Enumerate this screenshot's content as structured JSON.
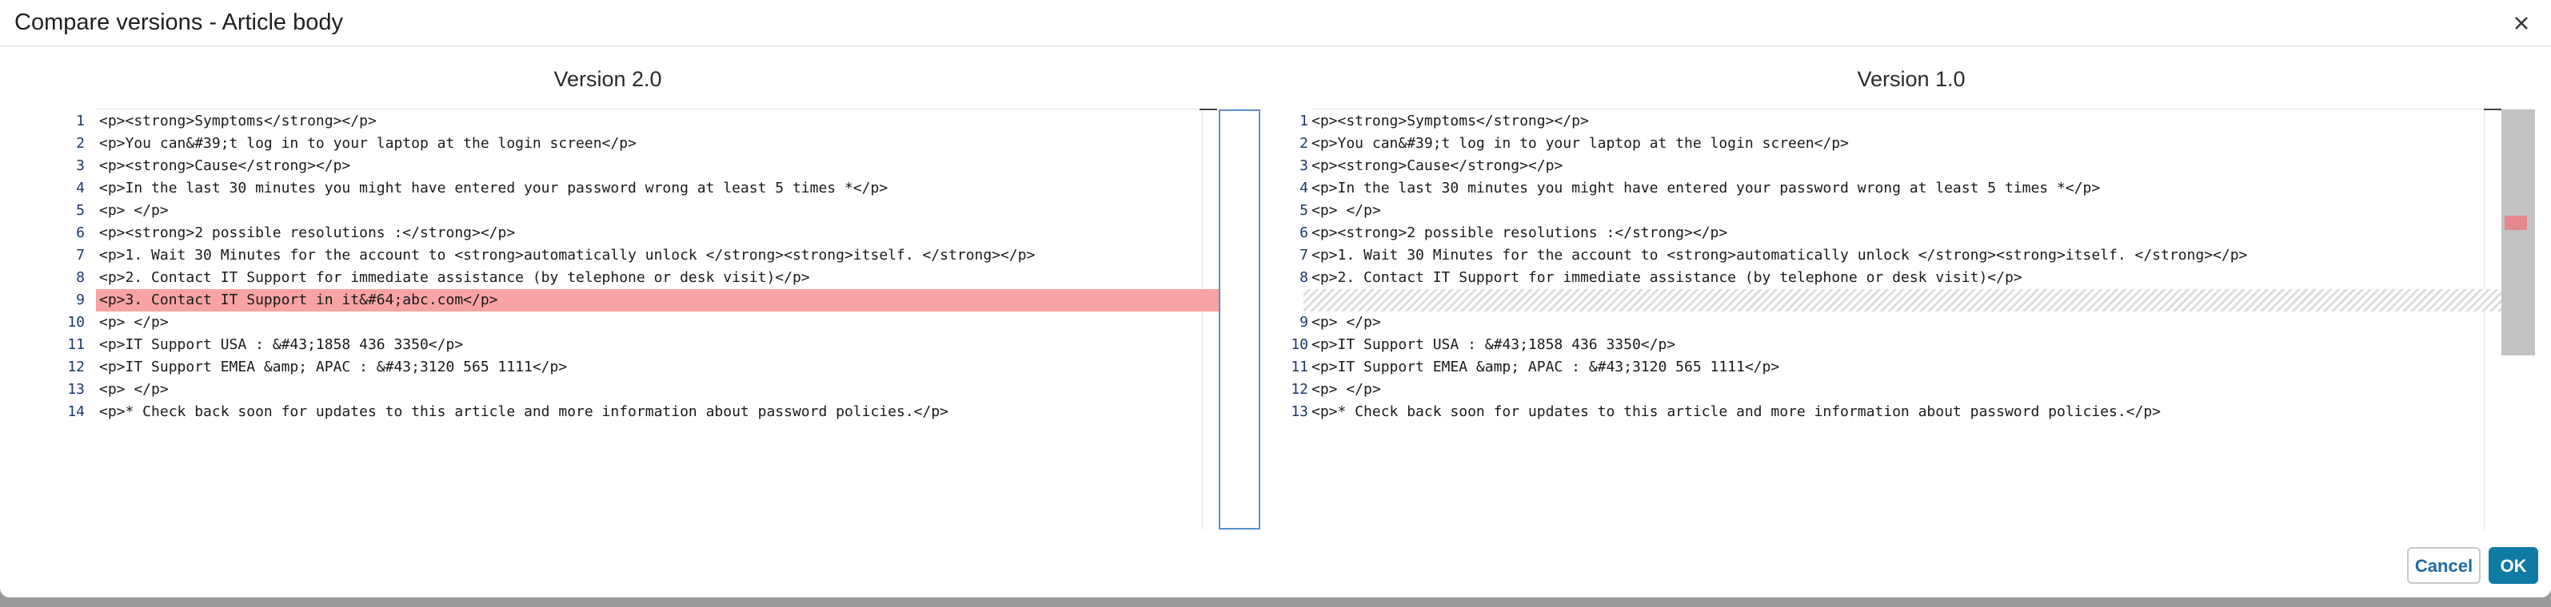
{
  "dialog": {
    "title": "Compare versions - Article body",
    "close_icon": "close-icon"
  },
  "left": {
    "title": "Version 2.0",
    "lines": [
      {
        "num": "1",
        "text": "<p><strong>Symptoms</strong></p>",
        "state": "normal"
      },
      {
        "num": "2",
        "text": "<p>You can&#39;t log in to your laptop at the login screen</p>",
        "state": "normal"
      },
      {
        "num": "3",
        "text": "<p><strong>Cause</strong></p>",
        "state": "normal"
      },
      {
        "num": "4",
        "text": "<p>In the last 30 minutes you might have entered your password wrong at least 5 times *</p>",
        "state": "normal"
      },
      {
        "num": "5",
        "text": "<p> </p>",
        "state": "normal"
      },
      {
        "num": "6",
        "text": "<p><strong>2 possible resolutions :</strong></p>",
        "state": "normal"
      },
      {
        "num": "7",
        "text": "<p>1. Wait 30 Minutes for the account to <strong>automatically unlock </strong><strong>itself. </strong></p>",
        "state": "normal"
      },
      {
        "num": "8",
        "text": "<p>2. Contact IT Support for immediate assistance (by telephone or desk visit)</p>",
        "state": "normal"
      },
      {
        "num": "9",
        "text": "<p>3. Contact IT Support in it&#64;abc.com</p>",
        "state": "removed"
      },
      {
        "num": "10",
        "text": "<p> </p>",
        "state": "normal"
      },
      {
        "num": "11",
        "text": "<p>IT Support USA : &#43;1858 436 3350</p>",
        "state": "normal"
      },
      {
        "num": "12",
        "text": "<p>IT Support EMEA &amp; APAC : &#43;3120 565 1111</p>",
        "state": "normal"
      },
      {
        "num": "13",
        "text": "<p> </p>",
        "state": "normal"
      },
      {
        "num": "14",
        "text": "<p>* Check back soon for updates to this article and more information about password policies.</p>",
        "state": "normal"
      }
    ]
  },
  "right": {
    "title": "Version 1.0",
    "lines": [
      {
        "num": "1",
        "text": "<p><strong>Symptoms</strong></p>",
        "state": "normal"
      },
      {
        "num": "2",
        "text": "<p>You can&#39;t log in to your laptop at the login screen</p>",
        "state": "normal"
      },
      {
        "num": "3",
        "text": "<p><strong>Cause</strong></p>",
        "state": "normal"
      },
      {
        "num": "4",
        "text": "<p>In the last 30 minutes you might have entered your password wrong at least 5 times *</p>",
        "state": "normal"
      },
      {
        "num": "5",
        "text": "<p> </p>",
        "state": "normal"
      },
      {
        "num": "6",
        "text": "<p><strong>2 possible resolutions :</strong></p>",
        "state": "normal"
      },
      {
        "num": "7",
        "text": "<p>1. Wait 30 Minutes for the account to <strong>automatically unlock </strong><strong>itself. </strong></p>",
        "state": "normal"
      },
      {
        "num": "8",
        "text": "<p>2. Contact IT Support for immediate assistance (by telephone or desk visit)</p>",
        "state": "normal"
      },
      {
        "num": "",
        "text": "",
        "state": "placeholder"
      },
      {
        "num": "9",
        "text": "<p> </p>",
        "state": "normal"
      },
      {
        "num": "10",
        "text": "<p>IT Support USA : &#43;1858 436 3350</p>",
        "state": "normal"
      },
      {
        "num": "11",
        "text": "<p>IT Support EMEA &amp; APAC : &#43;3120 565 1111</p>",
        "state": "normal"
      },
      {
        "num": "12",
        "text": "<p> </p>",
        "state": "normal"
      },
      {
        "num": "13",
        "text": "<p>* Check back soon for updates to this article and more information about password policies.</p>",
        "state": "normal"
      }
    ]
  },
  "buttons": {
    "cancel_label": "Cancel",
    "ok_label": "OK"
  },
  "colors": {
    "removed_row": "#f8a3a3",
    "accent": "#0f7aa3",
    "overview_marker": "#e4888d"
  }
}
